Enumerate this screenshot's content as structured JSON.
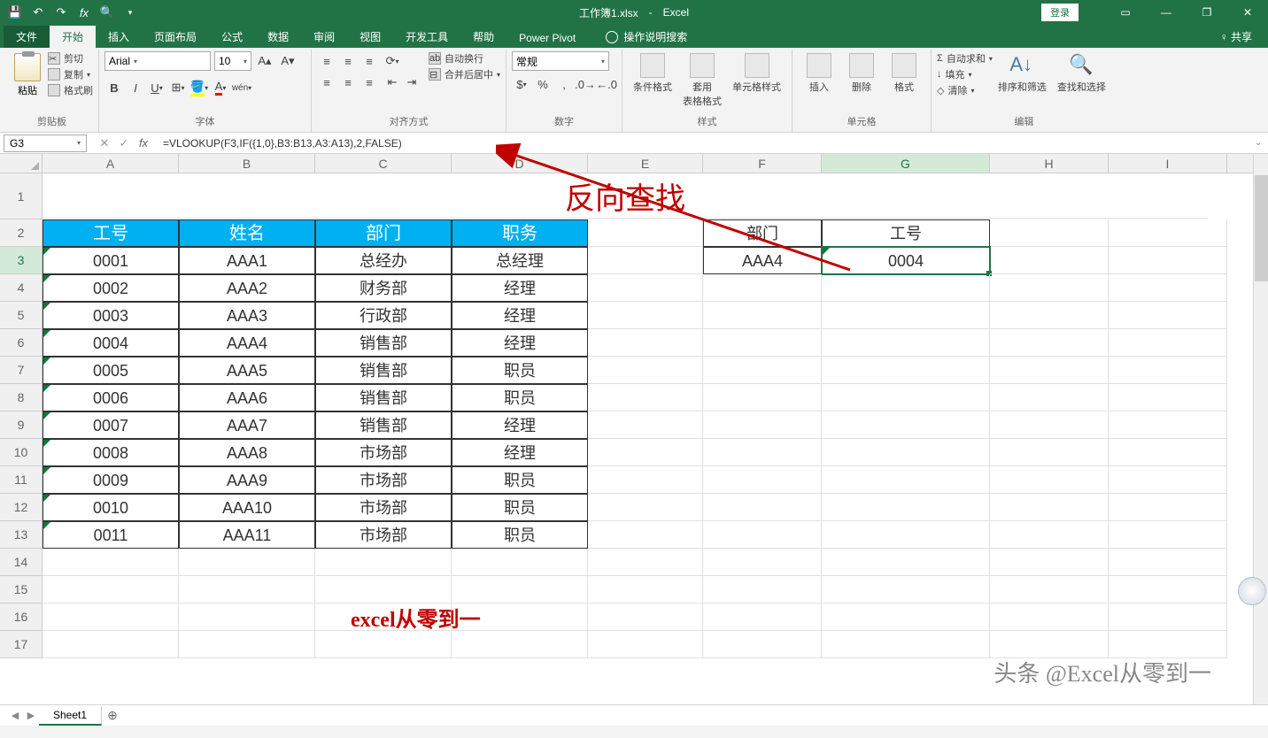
{
  "title": {
    "filename": "工作簿1.xlsx",
    "app": "Excel",
    "login": "登录",
    "share": "共享"
  },
  "tabs": {
    "file": "文件",
    "home": "开始",
    "insert": "插入",
    "layout": "页面布局",
    "formulas": "公式",
    "data": "数据",
    "review": "审阅",
    "view": "视图",
    "dev": "开发工具",
    "help": "帮助",
    "power": "Power Pivot",
    "tellme": "操作说明搜索"
  },
  "ribbon": {
    "clipboard": {
      "paste": "粘贴",
      "cut": "剪切",
      "copy": "复制",
      "painter": "格式刷",
      "label": "剪贴板"
    },
    "font": {
      "name": "Arial",
      "size": "10",
      "bold": "B",
      "italic": "I",
      "underline": "U",
      "wen": "wén",
      "label": "字体"
    },
    "align": {
      "wrap": "自动换行",
      "merge": "合并后居中",
      "label": "对齐方式"
    },
    "number": {
      "format": "常规",
      "label": "数字"
    },
    "styles": {
      "cond": "条件格式",
      "table": "套用\n表格格式",
      "cell": "单元格样式",
      "label": "样式"
    },
    "cells": {
      "insert": "插入",
      "delete": "删除",
      "format": "格式",
      "label": "单元格"
    },
    "editing": {
      "sum": "自动求和",
      "fill": "填充",
      "clear": "清除",
      "sort": "排序和筛选",
      "find": "查找和选择",
      "label": "编辑"
    }
  },
  "formula": {
    "cell": "G3",
    "value": "=VLOOKUP(F3,IF({1,0},B3:B13,A3:A13),2,FALSE)"
  },
  "columns": [
    "A",
    "B",
    "C",
    "D",
    "E",
    "F",
    "G",
    "H",
    "I"
  ],
  "row1Title": "反向查找",
  "tableHeaders": {
    "a": "工号",
    "b": "姓名",
    "c": "部门",
    "d": "职务"
  },
  "rightHeaders": {
    "f": "部门",
    "g": "工号"
  },
  "rightData": {
    "f": "AAA4",
    "g": "0004"
  },
  "data": [
    {
      "a": "0001",
      "b": "AAA1",
      "c": "总经办",
      "d": "总经理"
    },
    {
      "a": "0002",
      "b": "AAA2",
      "c": "财务部",
      "d": "经理"
    },
    {
      "a": "0003",
      "b": "AAA3",
      "c": "行政部",
      "d": "经理"
    },
    {
      "a": "0004",
      "b": "AAA4",
      "c": "销售部",
      "d": "经理"
    },
    {
      "a": "0005",
      "b": "AAA5",
      "c": "销售部",
      "d": "职员"
    },
    {
      "a": "0006",
      "b": "AAA6",
      "c": "销售部",
      "d": "职员"
    },
    {
      "a": "0007",
      "b": "AAA7",
      "c": "销售部",
      "d": "经理"
    },
    {
      "a": "0008",
      "b": "AAA8",
      "c": "市场部",
      "d": "经理"
    },
    {
      "a": "0009",
      "b": "AAA9",
      "c": "市场部",
      "d": "职员"
    },
    {
      "a": "0010",
      "b": "AAA10",
      "c": "市场部",
      "d": "职员"
    },
    {
      "a": "0011",
      "b": "AAA11",
      "c": "市场部",
      "d": "职员"
    }
  ],
  "footerText": "excel从零到一",
  "watermark": "头条 @Excel从零到一",
  "sheet": "Sheet1"
}
